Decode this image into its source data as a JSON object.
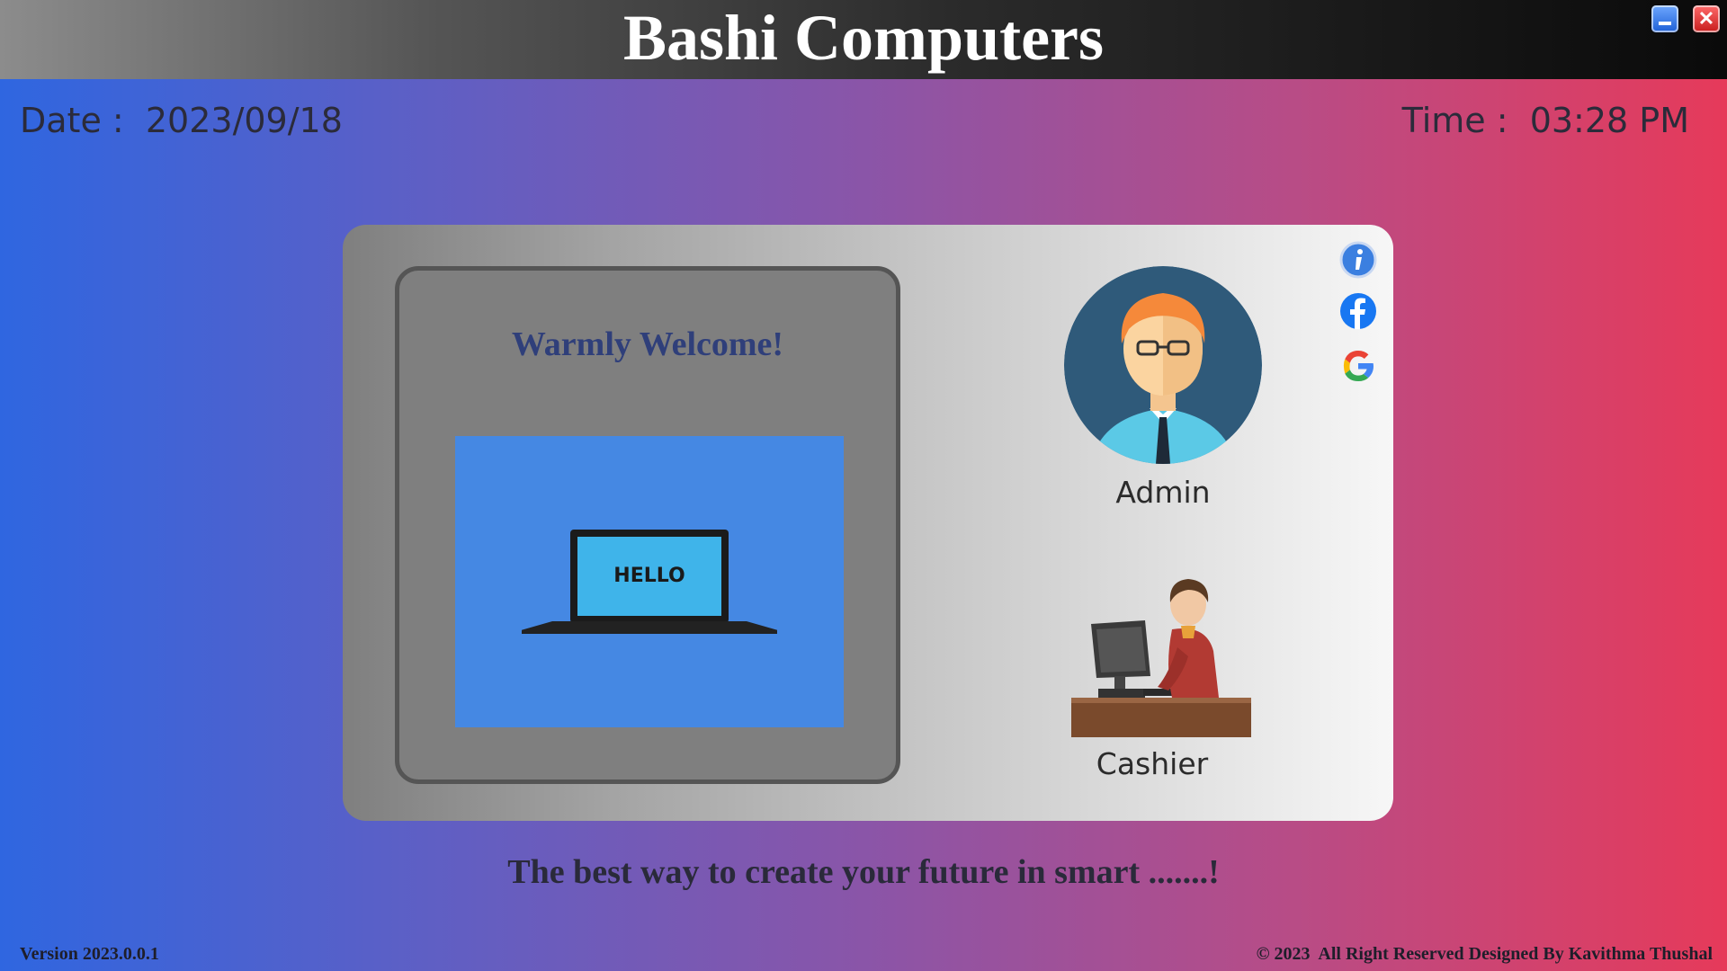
{
  "window": {
    "title": "Bashi Computers",
    "minimize_icon": "minimize-icon",
    "close_icon": "close-icon",
    "close_glyph": "✕"
  },
  "header": {
    "date_label": "Date :  2023/09/18",
    "time_label": "Time :  03:28 PM"
  },
  "welcome": {
    "heading": "Warmly Welcome!",
    "screen_text": "HELLO"
  },
  "roles": {
    "admin": {
      "label": "Admin",
      "icon": "admin-avatar-icon"
    },
    "cashier": {
      "label": "Cashier",
      "icon": "cashier-icon"
    }
  },
  "side_links": [
    {
      "icon": "info-icon"
    },
    {
      "icon": "facebook-icon"
    },
    {
      "icon": "google-icon"
    }
  ],
  "tagline": "The best way to create your future in smart .......!",
  "footer": {
    "version": "Version 2023.0.0.1",
    "copyright": "© 2023  All Right Reserved Designed By Kavithma Thushal"
  },
  "colors": {
    "background_left": "#2f66e0",
    "background_right": "#e63a5a",
    "welcome_heading": "#2f3f7a",
    "hello_panel": "#4588e3"
  }
}
